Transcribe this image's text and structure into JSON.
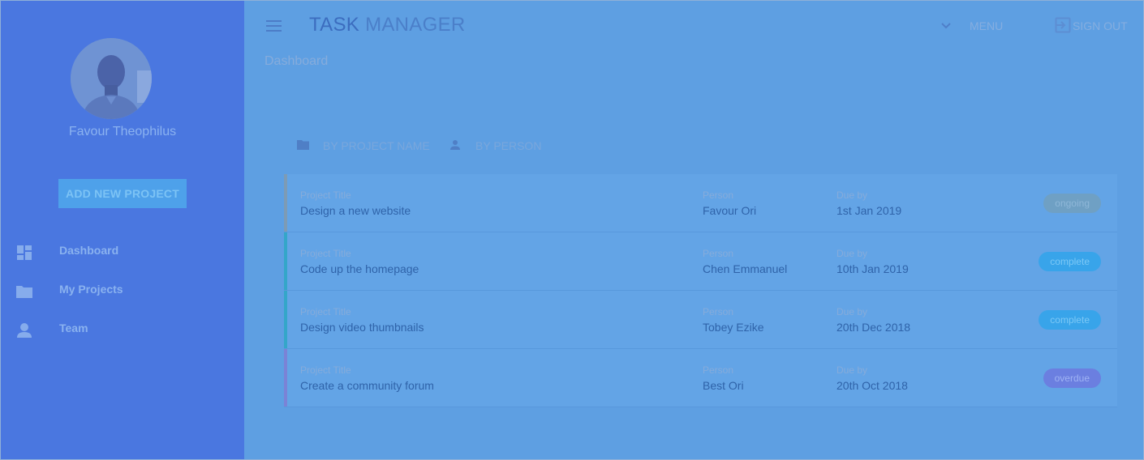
{
  "header": {
    "title_bold": "TASK",
    "title_light": "MANAGER",
    "menu_label": "MENU",
    "signout_label": "SIGN OUT",
    "breadcrumb": "Dashboard"
  },
  "sidebar": {
    "user_name": "Favour Theophilus",
    "add_button": "ADD NEW PROJECT",
    "items": [
      {
        "label": "Dashboard",
        "icon": "dashboard-icon"
      },
      {
        "label": "My Projects",
        "icon": "folder-icon"
      },
      {
        "label": "Team",
        "icon": "person-icon"
      }
    ]
  },
  "sort": {
    "by_project": "BY PROJECT NAME",
    "by_person": "BY PERSON"
  },
  "columns": {
    "project": "Project Title",
    "person": "Person",
    "due": "Due by"
  },
  "projects": [
    {
      "title": "Design a new website",
      "person": "Favour Ori",
      "due": "1st Jan 2019",
      "status": "ongoing",
      "status_color": "#6fa0c4",
      "status_text_color": "#8fb7d8",
      "accent": "#7d9bb5"
    },
    {
      "title": "Code up the homepage",
      "person": "Chen Emmanuel",
      "due": "10th Jan 2019",
      "status": "complete",
      "status_color": "#38a4ea",
      "status_text_color": "#7cc8f6",
      "accent": "#34a6c9"
    },
    {
      "title": "Design video thumbnails",
      "person": "Tobey Ezike",
      "due": "20th Dec 2018",
      "status": "complete",
      "status_color": "#38a4ea",
      "status_text_color": "#7cc8f6",
      "accent": "#34a6c9"
    },
    {
      "title": "Create a community forum",
      "person": "Best Ori",
      "due": "20th Oct 2018",
      "status": "overdue",
      "status_color": "#6b7fe0",
      "status_text_color": "#9fb3f4",
      "accent": "#7a83d6"
    }
  ]
}
